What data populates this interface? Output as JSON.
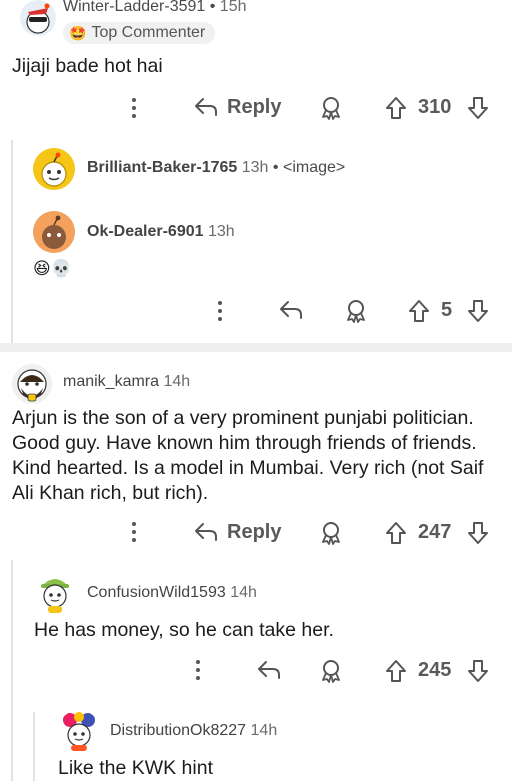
{
  "comments": [
    {
      "user": "Winter-Ladder-3591",
      "time": "15h",
      "badge": "Top Commenter",
      "text": "Jijaji bade hot hai",
      "reply_label": "Reply",
      "votes": "310"
    },
    {
      "user": "Brilliant-Baker-1765",
      "time": "13h",
      "sep": "•",
      "tag": "<image>"
    },
    {
      "user": "Ok-Dealer-6901",
      "time": "13h",
      "emoji": "😆💀",
      "votes": "5"
    },
    {
      "user": "manik_kamra",
      "time": "14h",
      "text": "Arjun is the son of a very prominent punjabi politician. Good guy. Have known him through friends of friends. Kind hearted. Is a model in Mumbai. Very rich (not Saif Ali Khan rich, but rich).",
      "reply_label": "Reply",
      "votes": "247"
    },
    {
      "user": "ConfusionWild1593",
      "time": "14h",
      "text": "He has money, so he can take her.",
      "votes": "245"
    },
    {
      "user": "DistributionOk8227",
      "time": "14h",
      "text": "Like the KWK hint"
    }
  ],
  "icons": {
    "more": "more-vertical-icon",
    "reply": "reply-arrow-icon",
    "award": "award-icon",
    "upvote": "upvote-arrow-icon",
    "downvote": "downvote-arrow-icon"
  },
  "colors": {
    "text": "#1c1c1c",
    "meta": "#5a5a5a",
    "divider": "#eeeeee",
    "thread": "#e2e2e2"
  }
}
